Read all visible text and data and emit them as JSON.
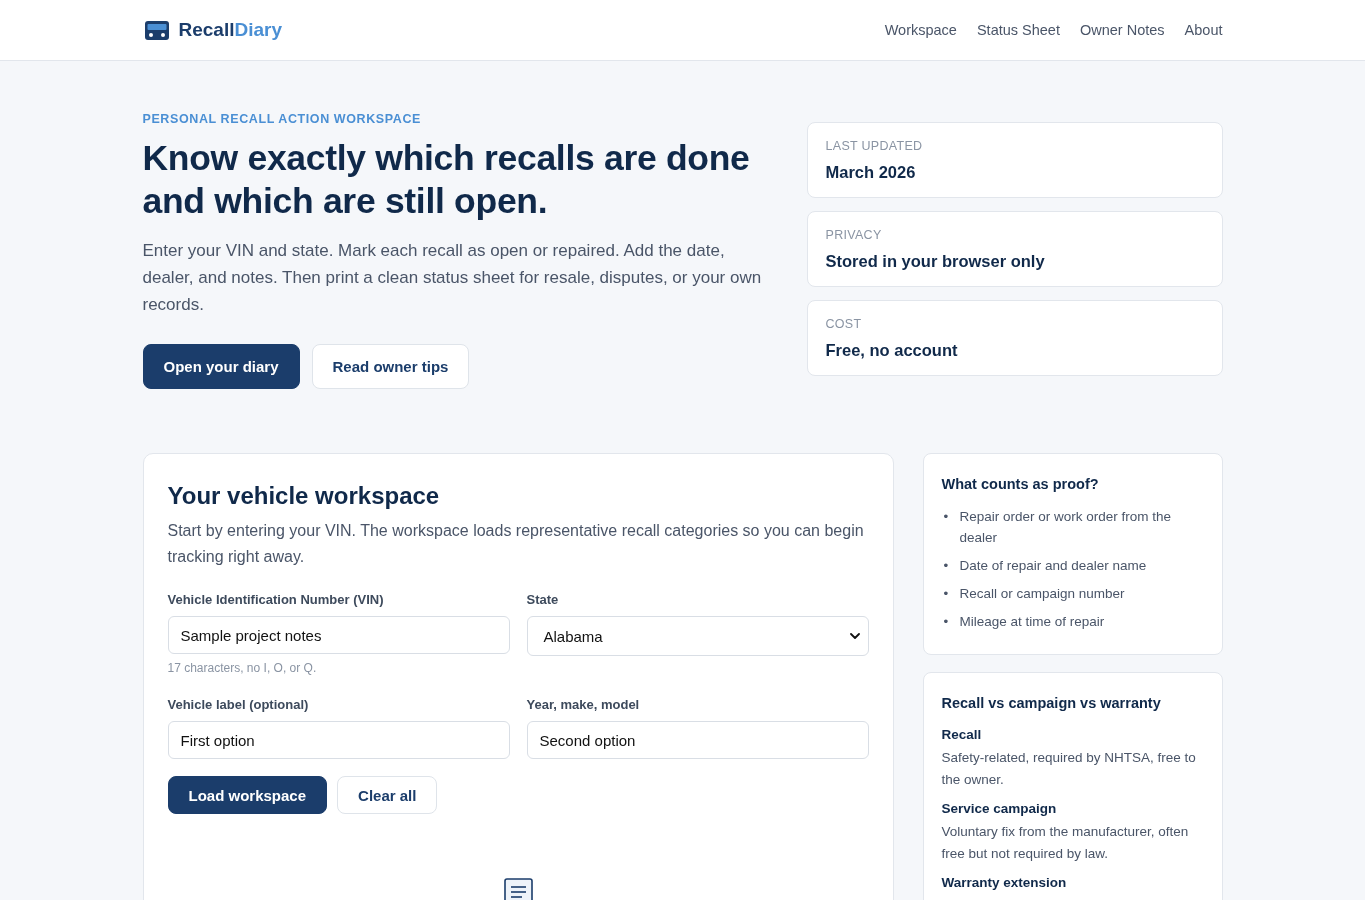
{
  "header": {
    "logo": {
      "primary": "Recall",
      "accent": "Diary"
    },
    "nav": [
      "Workspace",
      "Status Sheet",
      "Owner Notes",
      "About"
    ]
  },
  "hero": {
    "eyebrow": "PERSONAL RECALL ACTION WORKSPACE",
    "title": "Know exactly which recalls are done and which are still open.",
    "description": "Enter your VIN and state. Mark each recall as open or repaired. Add the date, dealer, and notes. Then print a clean status sheet for resale, disputes, or your own records.",
    "buttons": [
      {
        "label": "Open your diary",
        "kind": "primary"
      },
      {
        "label": "Read owner tips",
        "kind": "secondary"
      }
    ]
  },
  "facts": [
    {
      "label": "LAST UPDATED",
      "value": "March 2026"
    },
    {
      "label": "PRIVACY",
      "value": "Stored in your browser only"
    },
    {
      "label": "COST",
      "value": "Free, no account"
    }
  ],
  "workspace": {
    "title": "Your vehicle workspace",
    "description": "Start by entering your VIN. The workspace loads representative recall categories so you can begin tracking right away.",
    "fields": [
      {
        "kind": "text",
        "label": "Vehicle Identification Number (VIN)",
        "value": "Sample project notes",
        "hint": "17 characters, no I, O, or Q."
      },
      {
        "kind": "select",
        "label": "State",
        "value": "Alabama"
      },
      {
        "kind": "text",
        "label": "Vehicle label (optional)",
        "value": "First option"
      },
      {
        "kind": "text",
        "label": "Year, make, model",
        "value": "Second option"
      }
    ],
    "buttons": [
      {
        "label": "Load workspace",
        "kind": "primary"
      },
      {
        "label": "Clear all",
        "kind": "secondary"
      }
    ]
  },
  "proof_card": {
    "title": "What counts as proof?",
    "items": [
      {
        "marker": "•",
        "text": "Repair order or work order from the dealer"
      },
      {
        "marker": "•",
        "text": "Date of repair and dealer name"
      },
      {
        "marker": "•",
        "text": "Recall or campaign number"
      },
      {
        "marker": "•",
        "text": "Mileage at time of repair"
      }
    ]
  },
  "terms_card": {
    "title": "Recall vs campaign vs warranty",
    "terms": [
      {
        "term": "Recall",
        "definition": "Safety-related, required by NHTSA, free to the owner."
      },
      {
        "term": "Service campaign",
        "definition": "Voluntary fix from the manufacturer, often free but not required by law."
      },
      {
        "term": "Warranty extension"
      }
    ]
  }
}
